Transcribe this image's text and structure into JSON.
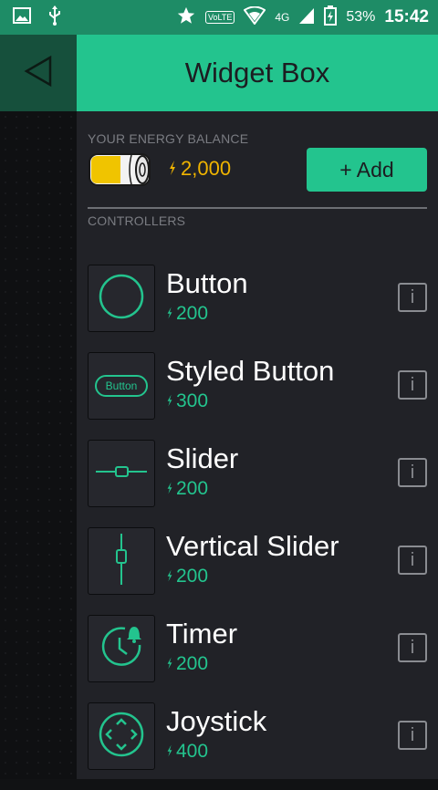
{
  "status_bar": {
    "battery_percent": "53%",
    "time": "15:42",
    "volte": "VoLTE",
    "network": "4G"
  },
  "header": {
    "title": "Widget Box"
  },
  "energy": {
    "label": "YOUR ENERGY BALANCE",
    "value": "2,000",
    "add_label": "+ Add"
  },
  "controllers": {
    "label": "CONTROLLERS",
    "items": [
      {
        "name": "Button",
        "cost": "200",
        "icon": "circle-button-icon"
      },
      {
        "name": "Styled Button",
        "cost": "300",
        "icon": "styled-button-icon",
        "icon_text": "Button"
      },
      {
        "name": "Slider",
        "cost": "200",
        "icon": "slider-icon"
      },
      {
        "name": "Vertical Slider",
        "cost": "200",
        "icon": "vertical-slider-icon"
      },
      {
        "name": "Timer",
        "cost": "200",
        "icon": "timer-icon"
      },
      {
        "name": "Joystick",
        "cost": "400",
        "icon": "joystick-icon"
      }
    ]
  },
  "colors": {
    "accent": "#23c48e",
    "energy": "#f0b400",
    "background": "#212227"
  }
}
